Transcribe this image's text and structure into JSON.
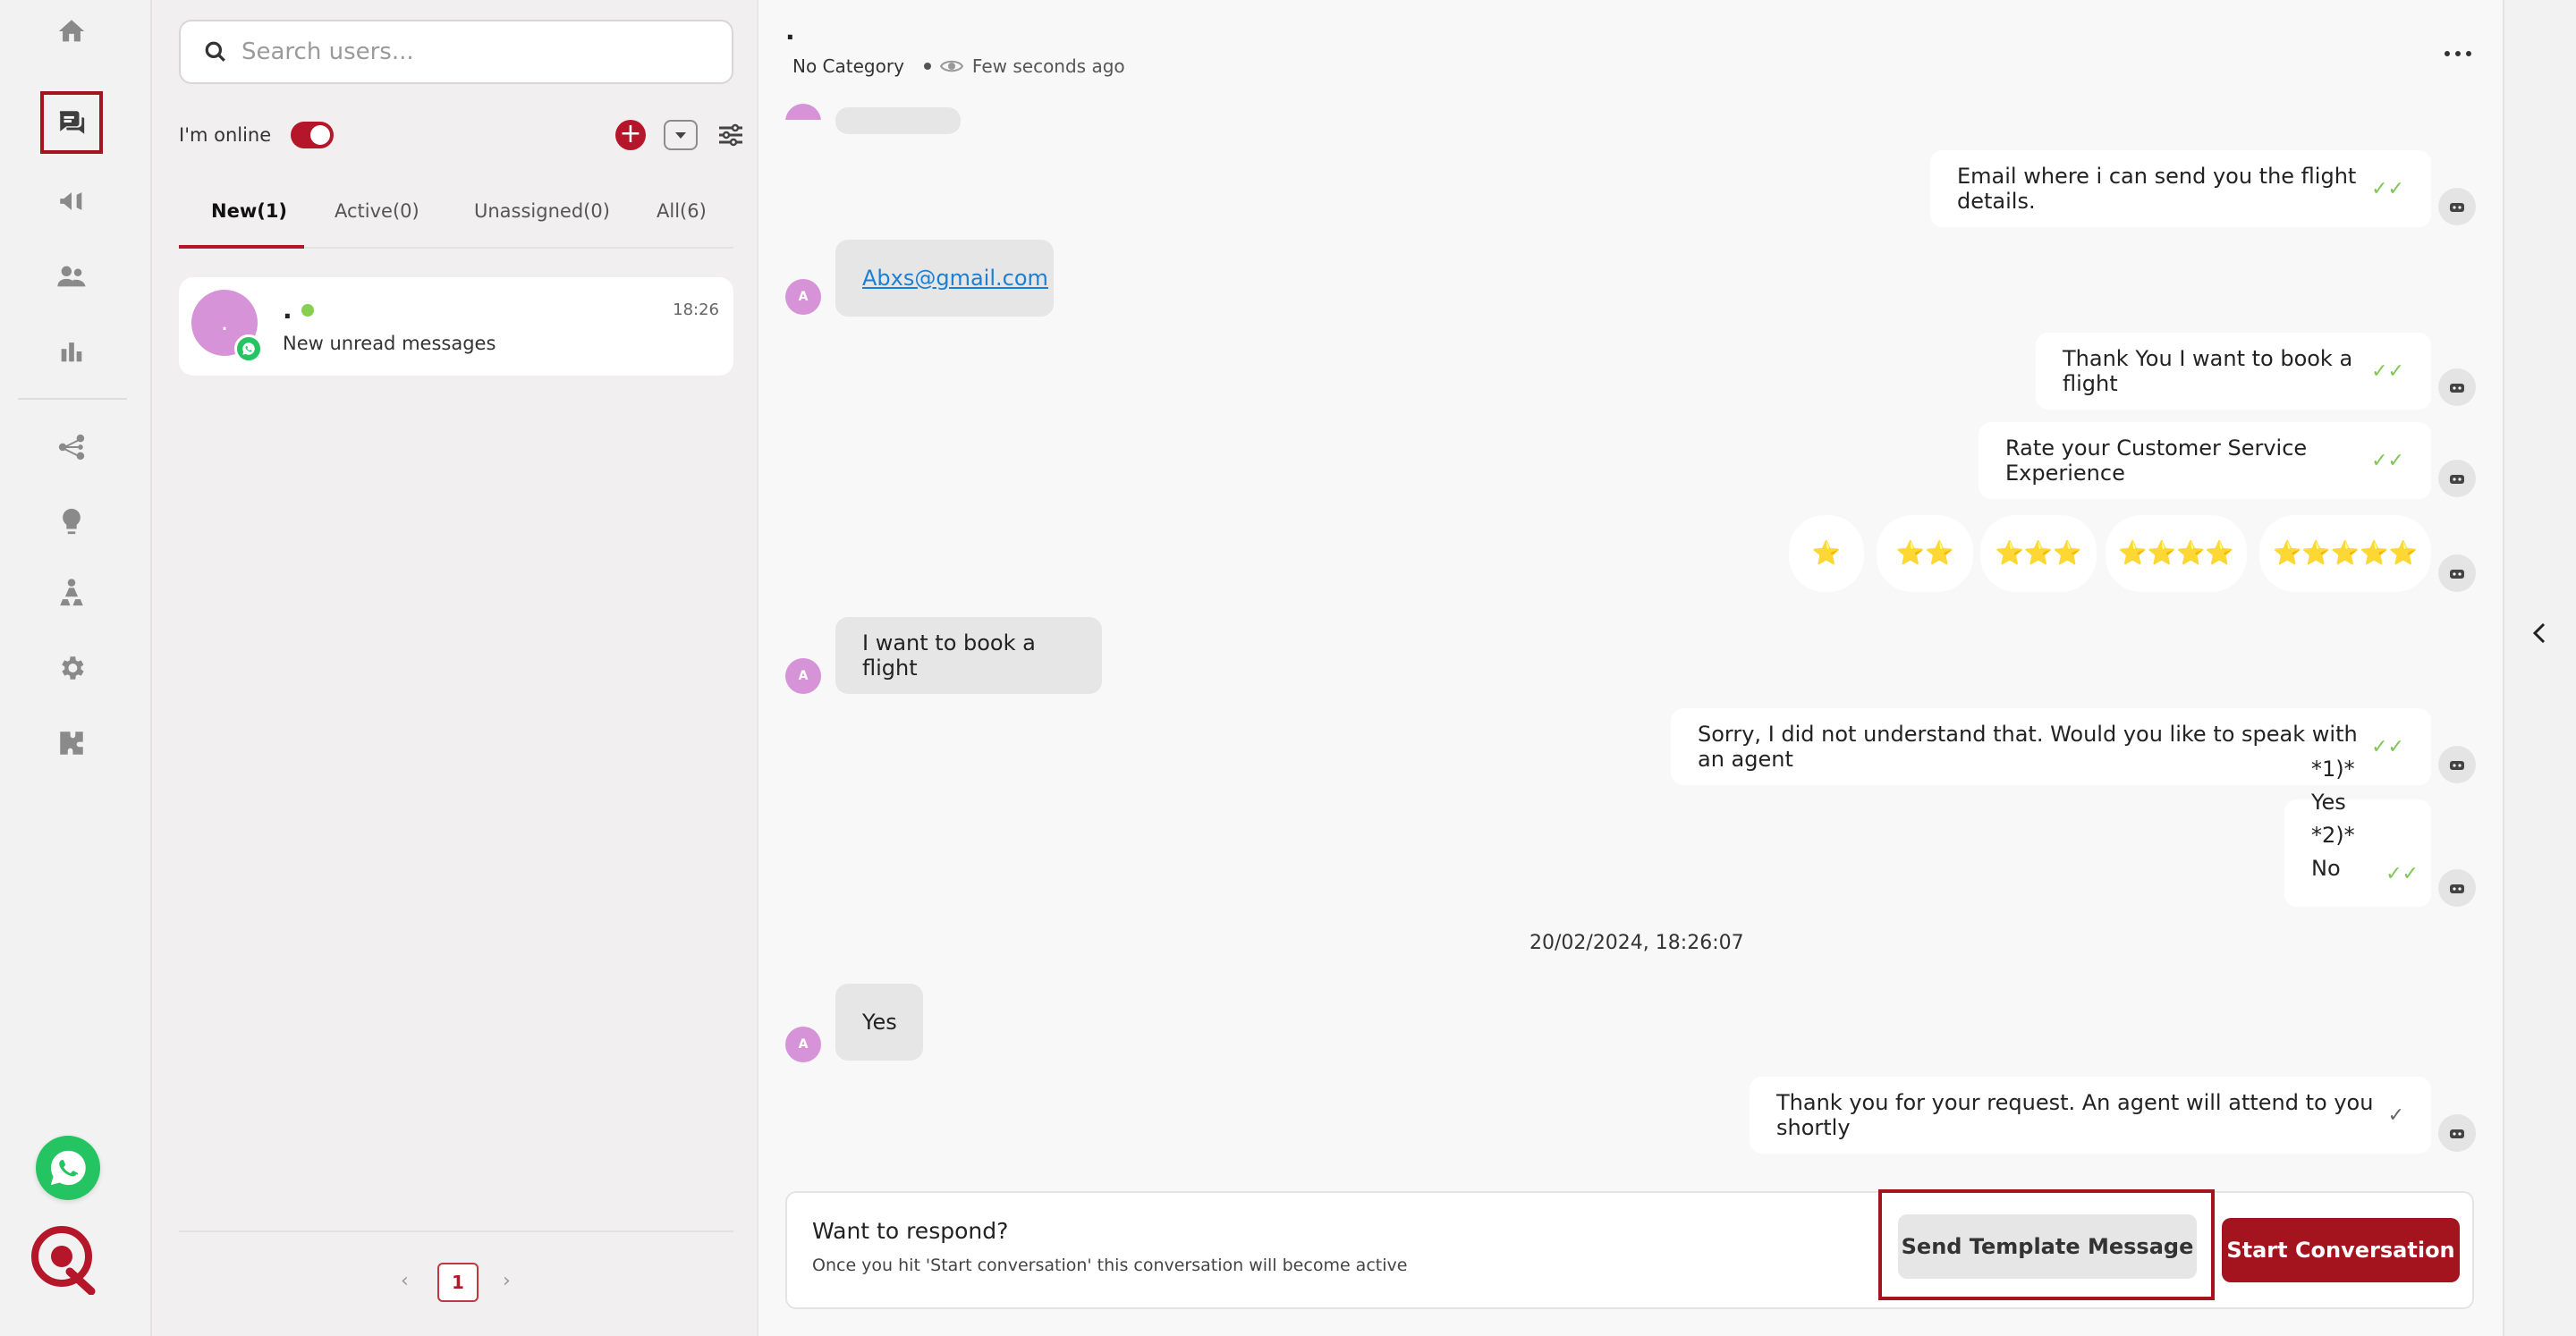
{
  "nav": {
    "items": [
      {
        "name": "home-icon",
        "active": false
      },
      {
        "name": "chat-icon",
        "active": true
      },
      {
        "name": "megaphone-icon",
        "active": false
      },
      {
        "name": "contacts-icon",
        "active": false
      },
      {
        "name": "bar-chart-icon",
        "active": false
      },
      {
        "name": "flow-icon",
        "active": false
      },
      {
        "name": "lightbulb-icon",
        "active": false
      },
      {
        "name": "org-chart-icon",
        "active": false
      },
      {
        "name": "gear-icon",
        "active": false
      },
      {
        "name": "puzzle-icon",
        "active": false
      }
    ],
    "active_color": "#a3141f"
  },
  "users_panel": {
    "search_placeholder": "Search users...",
    "online_label": "I'm online",
    "online": true,
    "tabs": [
      {
        "label": "New(1)",
        "active": true
      },
      {
        "label": "Active(0)",
        "active": false
      },
      {
        "label": "Unassigned(0)",
        "active": false
      },
      {
        "label": "All(6)",
        "active": false
      }
    ],
    "chats": [
      {
        "avatar_initial": ".",
        "name": ".",
        "time": "18:26",
        "preview": "New unread messages",
        "channel": "whatsapp-icon",
        "online": true
      }
    ],
    "pagination": {
      "current": "1",
      "prev": "‹",
      "next": "›"
    }
  },
  "conversation": {
    "contact_name": ".",
    "category": "No Category",
    "last_seen": "Few seconds ago",
    "avatar_initial": "A",
    "messages": [
      {
        "dir": "out",
        "text": "Email where i can send you the flight details.",
        "status": "read"
      },
      {
        "dir": "in",
        "text": "Abxs@gmail.com",
        "link": true
      },
      {
        "dir": "out",
        "text": "Thank You I want to book a flight",
        "status": "read"
      },
      {
        "dir": "out",
        "text": "Rate your Customer Service Experience",
        "status": "read"
      },
      {
        "dir": "in",
        "text": "I want to book a flight"
      },
      {
        "dir": "out",
        "text": "Sorry, I did not understand that. Would you like to speak with an agent",
        "status": "read"
      },
      {
        "dir": "out",
        "text": "*1)* Yes",
        "text2": "*2)* No",
        "status": "read"
      },
      {
        "dir": "in",
        "text": "Yes"
      },
      {
        "dir": "out",
        "text": "Thank you for your request. An agent will attend to you shortly",
        "status": "sent"
      }
    ],
    "rating_options": [
      "⭐",
      "⭐⭐",
      "⭐⭐⭐",
      "⭐⭐⭐⭐",
      "⭐⭐⭐⭐⭐"
    ],
    "datestamp": "20/02/2024, 18:26:07",
    "tick_read": "✓✓",
    "tick_sent": "✓",
    "tick_read_color": "#7fc754"
  },
  "composer": {
    "title": "Want to respond?",
    "subtitle": "Once you hit 'Start conversation' this conversation will become active",
    "send_template_label": "Send Template Message",
    "start_label": "Start Conversation"
  },
  "colors": {
    "brand": "#a3141f",
    "avatar": "#d693d8",
    "whatsapp": "#25c462"
  }
}
